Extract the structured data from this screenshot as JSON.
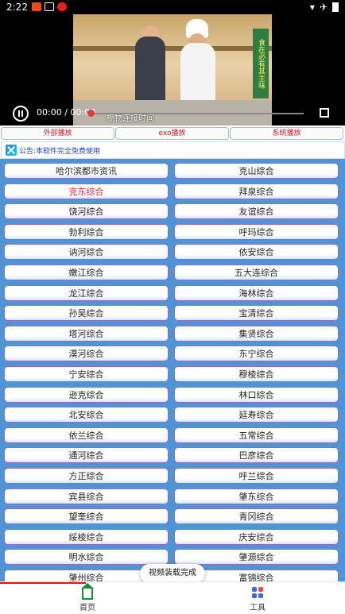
{
  "status_bar": {
    "time": "2:22"
  },
  "video": {
    "current_time": "00:00",
    "separator": "/",
    "duration": "00:00",
    "caption": "棚物连接时间",
    "side_banner": "食在必有其主味"
  },
  "player_tabs": [
    "外部播放",
    "exo播放",
    "系统播放"
  ],
  "notice": {
    "text": "公告:本软件完全免费使用"
  },
  "channels": [
    "哈尔滨都市资讯",
    "克山综合",
    "克东综合",
    "拜泉综合",
    "饶河综合",
    "友谊综合",
    "勃利综合",
    "呼玛综合",
    "讷河综合",
    "依安综合",
    "嫩江综合",
    "五大连综合",
    "龙江综合",
    "海林综合",
    "孙吴综合",
    "宝清综合",
    "塔河综合",
    "集贤综合",
    "漠河综合",
    "东宁综合",
    "宁安综合",
    "穆棱综合",
    "逊克综合",
    "林口综合",
    "北安综合",
    "延寿综合",
    "依兰综合",
    "五常综合",
    "通河综合",
    "巴彦综合",
    "方正综合",
    "呼兰综合",
    "宾县综合",
    "肇东综合",
    "望奎综合",
    "青冈综合",
    "绥棱综合",
    "庆安综合",
    "明水综合",
    "肇源综合",
    "肇州综合",
    "富锦综合"
  ],
  "active_channel_index": 2,
  "toast": "视频装载完成",
  "bottom_nav": [
    {
      "label": "首页",
      "icon": "home-icon"
    },
    {
      "label": "工具",
      "icon": "tools-icon"
    }
  ],
  "colors": {
    "grid_background": "#4f95d6",
    "active_text": "#d32f2f",
    "home_icon": "#1a8f3a",
    "nav_accent": "#e11"
  }
}
